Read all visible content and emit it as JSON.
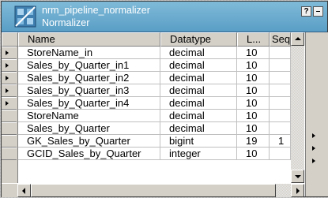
{
  "window": {
    "title": "nrm_pipeline_normalizer",
    "subtitle": "Normalizer",
    "help_label": "?",
    "minimize_label": "–",
    "icon": "normalizer-transformation-icon"
  },
  "table": {
    "columns": [
      "Name",
      "Datatype",
      "L...",
      "Seq"
    ],
    "rows": [
      {
        "name": "StoreName_in",
        "datatype": "decimal",
        "length": "10",
        "seq": ""
      },
      {
        "name": "Sales_by_Quarter_in1",
        "datatype": "decimal",
        "length": "10",
        "seq": ""
      },
      {
        "name": "Sales_by_Quarter_in2",
        "datatype": "decimal",
        "length": "10",
        "seq": ""
      },
      {
        "name": "Sales_by_Quarter_in3",
        "datatype": "decimal",
        "length": "10",
        "seq": ""
      },
      {
        "name": "Sales_by_Quarter_in4",
        "datatype": "decimal",
        "length": "10",
        "seq": ""
      },
      {
        "name": "StoreName",
        "datatype": "decimal",
        "length": "10",
        "seq": ""
      },
      {
        "name": "Sales_by_Quarter",
        "datatype": "decimal",
        "length": "10",
        "seq": ""
      },
      {
        "name": "GK_Sales_by_Quarter",
        "datatype": "bigint",
        "length": "19",
        "seq": "1"
      },
      {
        "name": "GCID_Sales_by_Quarter",
        "datatype": "integer",
        "length": "10",
        "seq": ""
      }
    ]
  },
  "colors": {
    "title_bar": "#5a9ec6",
    "title_text": "#ffffff",
    "grid_bg": "#ffffff",
    "chrome": "#d4d0c8"
  }
}
